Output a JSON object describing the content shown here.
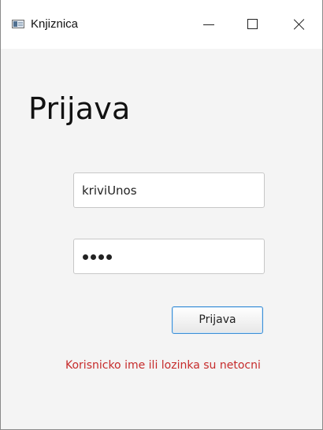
{
  "window": {
    "title": "Knjiznica",
    "icon": "java-app-icon",
    "controls": [
      "minimize-icon",
      "maximize-icon",
      "close-icon"
    ]
  },
  "form": {
    "heading": "Prijava",
    "username_value": "kriviUnos",
    "password_masked": "••••",
    "button_label": "Prijava",
    "error_message": "Korisnicko ime ili lozinka su netocni"
  },
  "colors": {
    "background": "#f4f4f4",
    "error": "#c62b2b",
    "focus_accent": "#3c8fd6"
  }
}
